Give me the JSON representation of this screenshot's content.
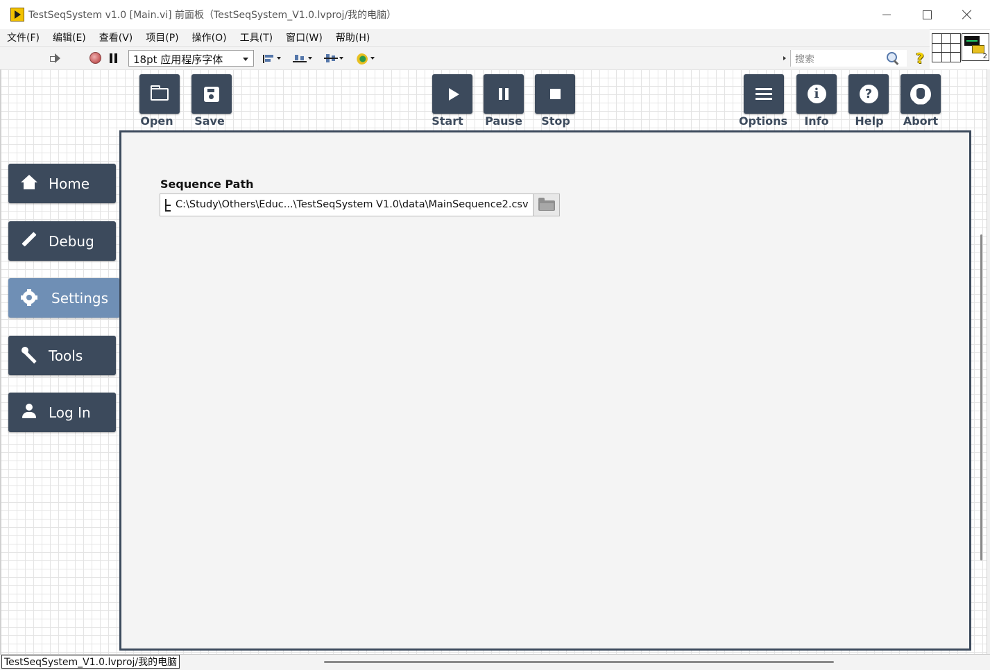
{
  "window": {
    "title": "TestSeqSystem v1.0 [Main.vi] 前面板（TestSeqSystem_V1.0.lvproj/我的电脑）"
  },
  "menu": [
    "文件(F)",
    "编辑(E)",
    "查看(V)",
    "项目(P)",
    "操作(O)",
    "工具(T)",
    "窗口(W)",
    "帮助(H)"
  ],
  "toolbar": {
    "font_select": "18pt 应用程序字体",
    "search_placeholder": "搜索",
    "vi_icon_number": "2"
  },
  "top_buttons": {
    "open": "Open",
    "save": "Save",
    "start": "Start",
    "pause": "Pause",
    "stop": "Stop",
    "options": "Options",
    "info": "Info",
    "help": "Help",
    "abort": "Abort"
  },
  "nav": {
    "items": [
      {
        "label": "Home",
        "icon": "home-icon"
      },
      {
        "label": "Debug",
        "icon": "pencil-icon"
      },
      {
        "label": "Settings",
        "icon": "gear-icon",
        "active": true
      },
      {
        "label": "Tools",
        "icon": "wrench-icon"
      },
      {
        "label": "Log In",
        "icon": "user-icon"
      }
    ]
  },
  "settings": {
    "sequence_path_label": "Sequence Path",
    "sequence_path_value": "C:\\Study\\Others\\Educ...\\TestSeqSystem V1.0\\data\\MainSequence2.csv"
  },
  "status": {
    "context": "TestSeqSystem_V1.0.lvproj/我的电脑"
  },
  "colors": {
    "button_dark": "#3c4a5c",
    "button_active": "#6f8fb5",
    "panel_bg": "#f4f4f4"
  }
}
